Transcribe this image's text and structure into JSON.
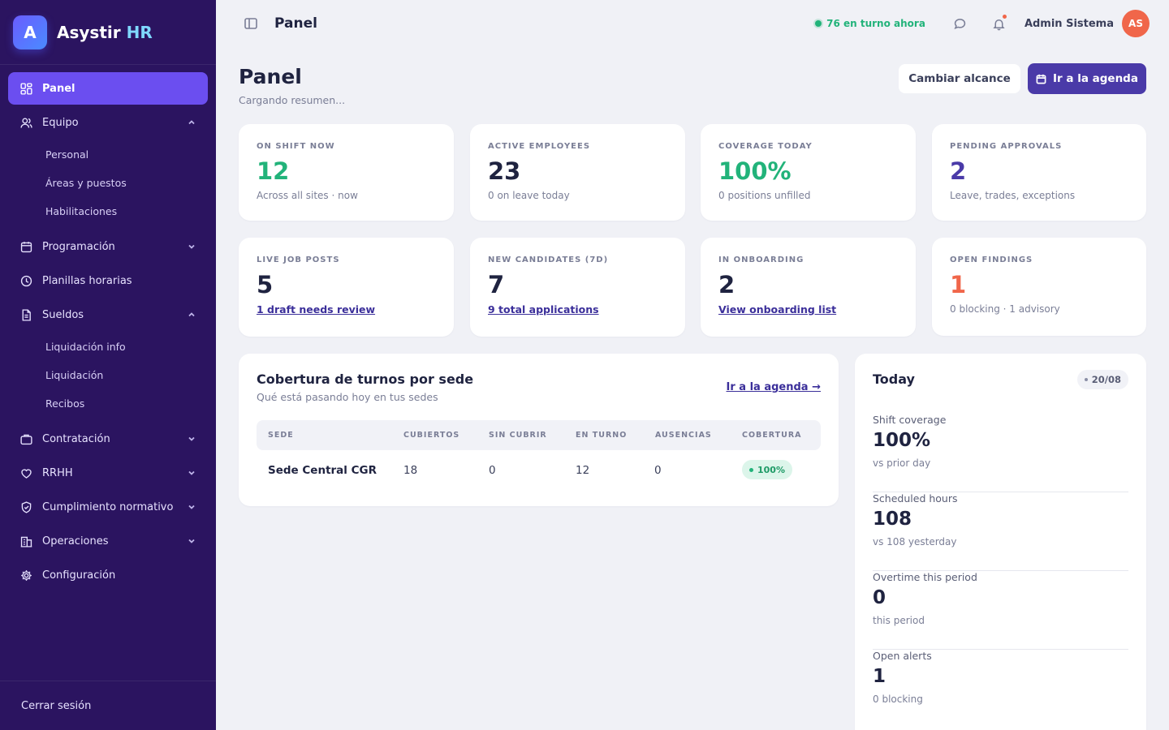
{
  "app": {
    "logo_letter": "A",
    "name": "Asystir",
    "name_accent": "HR"
  },
  "sidebar": {
    "items": [
      {
        "label": "Panel",
        "icon": "dashboard-icon",
        "active": true
      },
      {
        "label": "Equipo",
        "icon": "users-icon",
        "expanded": true
      },
      {
        "label": "Programación",
        "icon": "calendar-icon"
      },
      {
        "label": "Planillas horarias",
        "icon": "clock-icon"
      },
      {
        "label": "Sueldos",
        "icon": "document-icon",
        "expanded": true
      },
      {
        "label": "Contratación",
        "icon": "briefcase-icon"
      },
      {
        "label": "RRHH",
        "icon": "heart-icon"
      },
      {
        "label": "Cumplimiento normativo",
        "icon": "shield-icon"
      },
      {
        "label": "Operaciones",
        "icon": "building-icon"
      },
      {
        "label": "Configuración",
        "icon": "gear-icon"
      }
    ],
    "equipo_sub": [
      "Personal",
      "Áreas y puestos",
      "Habilitaciones"
    ],
    "sueldos_sub": [
      "Liquidación info",
      "Liquidación",
      "Recibos"
    ],
    "logout": "Cerrar sesión"
  },
  "topbar": {
    "title": "Panel",
    "on_shift": "76 en turno ahora",
    "user_name": "Admin Sistema",
    "avatar_initials": "AS"
  },
  "page": {
    "title": "Panel",
    "subtitle": "Cargando resumen...",
    "btn_scope": "Cambiar alcance",
    "btn_agenda": "Ir a la agenda"
  },
  "stats": [
    {
      "label": "ON SHIFT NOW",
      "value": "12",
      "meta": "Across all sites · now",
      "color": "#22b37a"
    },
    {
      "label": "ACTIVE EMPLOYEES",
      "value": "23",
      "meta": "0 on leave today",
      "color": "#1f2340"
    },
    {
      "label": "COVERAGE TODAY",
      "value": "100%",
      "meta": "0 positions unfilled",
      "color": "#22b37a"
    },
    {
      "label": "PENDING APPROVALS",
      "value": "2",
      "meta": "Leave, trades, exceptions",
      "color": "#4a3aa8"
    },
    {
      "label": "LIVE JOB POSTS",
      "value": "5",
      "link": "1 draft needs review",
      "color": "#1f2340"
    },
    {
      "label": "NEW CANDIDATES (7D)",
      "value": "7",
      "link": "9 total applications",
      "color": "#1f2340"
    },
    {
      "label": "IN ONBOARDING",
      "value": "2",
      "link": "View onboarding list",
      "color": "#1f2340"
    },
    {
      "label": "OPEN FINDINGS",
      "value": "1",
      "meta": "0 blocking · 1 advisory",
      "color": "#f0664a"
    }
  ],
  "coverage": {
    "title": "Cobertura de turnos por sede",
    "subtitle": "Qué está pasando hoy en tus sedes",
    "link": "Ir a la agenda →",
    "columns": [
      "SEDE",
      "CUBIERTOS",
      "SIN CUBRIR",
      "EN TURNO",
      "AUSENCIAS",
      "COBERTURA"
    ],
    "rows": [
      {
        "sede": "Sede Central CGR",
        "cubiertos": "18",
        "sin_cubrir": "0",
        "en_turno": "12",
        "ausencias": "0",
        "cobertura": "100%"
      }
    ]
  },
  "today": {
    "title": "Today",
    "date": "20/08",
    "metrics": [
      {
        "label": "Shift coverage",
        "value": "100%",
        "meta": "vs prior day"
      },
      {
        "label": "Scheduled hours",
        "value": "108",
        "meta": "vs 108 yesterday"
      },
      {
        "label": "Overtime this period",
        "value": "0",
        "meta": "this period"
      },
      {
        "label": "Open alerts",
        "value": "1",
        "meta": "0 blocking"
      }
    ]
  }
}
